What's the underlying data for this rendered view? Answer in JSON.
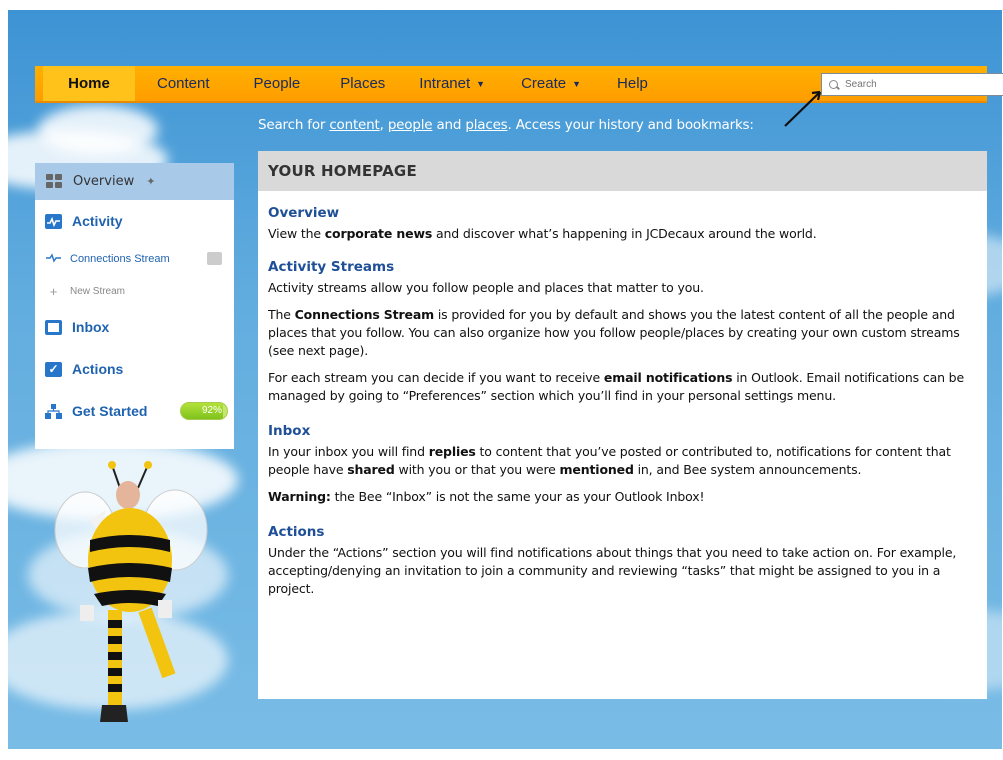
{
  "nav": {
    "items": [
      {
        "label": "Home",
        "name": "nav-home"
      },
      {
        "label": "Content",
        "name": "nav-content"
      },
      {
        "label": "People",
        "name": "nav-people"
      },
      {
        "label": "Places",
        "name": "nav-places"
      },
      {
        "label": "Intranet",
        "name": "nav-intranet",
        "caret": true
      },
      {
        "label": "Create",
        "name": "nav-create",
        "caret": true
      },
      {
        "label": "Help",
        "name": "nav-help"
      }
    ],
    "search_placeholder": "Search"
  },
  "hint": {
    "prefix": "Search for ",
    "link_content": "content",
    "sep1": ", ",
    "link_people": "people",
    "sep2": " and ",
    "link_places": "places",
    "suffix": ". Access your history and bookmarks:"
  },
  "sidebar": {
    "overview": "Overview",
    "activity": "Activity",
    "connections_stream": "Connections Stream",
    "new_stream": "New Stream",
    "inbox": "Inbox",
    "actions": "Actions",
    "get_started": "Get Started",
    "progress_percent": 92,
    "progress_label": "92%"
  },
  "main": {
    "title": "YOUR HOMEPAGE",
    "overview_heading": "Overview",
    "overview_pre": "View the ",
    "overview_bold": "corporate news",
    "overview_post": " and discover what’s happening in JCDecaux around the world.",
    "activity_heading": "Activity Streams",
    "activity_p1": "Activity streams allow you follow people and places that matter to you.",
    "activity_p2_pre": "The ",
    "activity_p2_bold": "Connections Stream",
    "activity_p2_post": " is provided for you by default and shows you the latest content of all the people and places that you follow.  You can also organize how you follow people/places by creating your own custom streams (see next page).",
    "activity_p3_pre": "For each stream you can decide if you want to receive ",
    "activity_p3_bold": "email notifications",
    "activity_p3_post": " in Outlook.  Email notifications can be managed by going to “Preferences” section which you’ll find in your personal settings menu.",
    "inbox_heading": "Inbox",
    "inbox_p1_a": "In your inbox you will find ",
    "inbox_p1_b": "replies",
    "inbox_p1_c": " to content that you’ve posted or contributed to, notifications for content that people have ",
    "inbox_p1_d": "shared",
    "inbox_p1_e": " with you or that you were ",
    "inbox_p1_f": "mentioned",
    "inbox_p1_g": " in, and Bee system announcements.",
    "inbox_warn_bold": "Warning:",
    "inbox_warn_rest": " the Bee “Inbox” is not the same your as your Outlook Inbox!",
    "actions_heading": "Actions",
    "actions_p": "Under the “Actions” section you will find notifications about things that you need to take action on.  For example, accepting/denying an invitation to join a community and reviewing “tasks” that might be assigned to you in a project."
  },
  "colors": {
    "nav_orange": "#ff9d00",
    "home_tab": "#ffc21a",
    "heading_blue": "#1f4f97",
    "link_blue": "#1f63b0",
    "sky": "#62addf"
  }
}
